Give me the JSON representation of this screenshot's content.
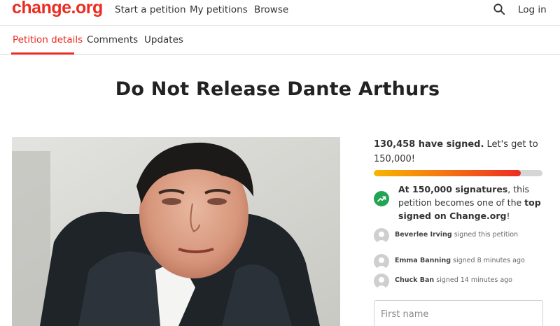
{
  "header": {
    "logo": "change.org",
    "nav": [
      "Start a petition",
      "My petitions",
      "Browse"
    ],
    "search_icon": "search-icon",
    "login_label": "Log in"
  },
  "tabs": [
    {
      "label": "Petition details",
      "active": true
    },
    {
      "label": "Comments",
      "active": false
    },
    {
      "label": "Updates",
      "active": false
    }
  ],
  "petition": {
    "title": "Do Not Release Dante Arthurs"
  },
  "signatures": {
    "count": "130,458 have signed.",
    "goal_text": "Let's get to 150,000!",
    "progress_fraction": 0.87
  },
  "milestone": {
    "icon": "trending-up-icon",
    "bold_prefix": "At 150,000 signatures",
    "middle": ", this petition becomes one of the",
    "bold_suffix": "top signed on Change.org",
    "end": "!"
  },
  "activity": [
    {
      "name": "Beverlee Irving",
      "action": "signed this petition"
    },
    {
      "name": "Emma Banning",
      "action": "signed 8 minutes ago"
    },
    {
      "name": "Chuck Ban",
      "action": "signed 14 minutes ago"
    }
  ],
  "form": {
    "first_name_placeholder": "First name"
  },
  "colors": {
    "brand": "#ec2c22",
    "milestone_green": "#21a453"
  }
}
